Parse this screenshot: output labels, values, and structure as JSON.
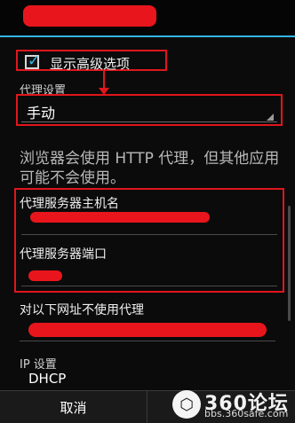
{
  "dialog": {
    "show_advanced_label": "显示高级选项",
    "show_advanced_checked": true,
    "proxy_settings_label": "代理设置",
    "proxy_mode_value": "手动",
    "info_text": "浏览器会使用 HTTP 代理，但其他应用可能不会使用。",
    "proxy_hostname_label": "代理服务器主机名",
    "proxy_port_label": "代理服务器端口",
    "bypass_label": "对以下网址不使用代理",
    "ip_settings_label": "IP 设置",
    "ip_mode_value": "DHCP",
    "cancel_label": "取消"
  },
  "watermark": {
    "circle_glyph": "⬡",
    "brand": "360论坛",
    "url": "bbs.360safe.com"
  },
  "colors": {
    "accent": "#33b5e5",
    "highlight": "#e0161d",
    "redaction": "#e8161c",
    "background": "#0b0b0b"
  }
}
